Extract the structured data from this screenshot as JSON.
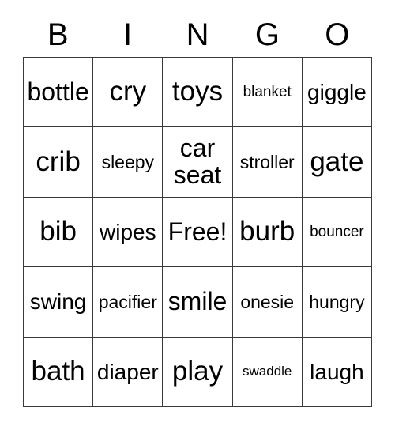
{
  "card": {
    "headers": [
      "B",
      "I",
      "N",
      "G",
      "O"
    ],
    "free_space_label": "Free!",
    "colors": {
      "background": "#ffffff",
      "border": "#3a3a3a",
      "text": "#000000"
    },
    "rows": [
      [
        {
          "label": "bottle",
          "size": "lg"
        },
        {
          "label": "cry",
          "size": "xl"
        },
        {
          "label": "toys",
          "size": "xl"
        },
        {
          "label": "blanket",
          "size": "xs"
        },
        {
          "label": "giggle",
          "size": "md"
        }
      ],
      [
        {
          "label": "crib",
          "size": "xl"
        },
        {
          "label": "sleepy",
          "size": "sm"
        },
        {
          "label": "car seat",
          "size": "lg"
        },
        {
          "label": "stroller",
          "size": "sm"
        },
        {
          "label": "gate",
          "size": "xl"
        }
      ],
      [
        {
          "label": "bib",
          "size": "xl"
        },
        {
          "label": "wipes",
          "size": "md"
        },
        {
          "label": "Free!",
          "size": "lg"
        },
        {
          "label": "burb",
          "size": "xl"
        },
        {
          "label": "bouncer",
          "size": "xs"
        }
      ],
      [
        {
          "label": "swing",
          "size": "md"
        },
        {
          "label": "pacifier",
          "size": "sm"
        },
        {
          "label": "smile",
          "size": "lg"
        },
        {
          "label": "onesie",
          "size": "sm"
        },
        {
          "label": "hungry",
          "size": "sm"
        }
      ],
      [
        {
          "label": "bath",
          "size": "xl"
        },
        {
          "label": "diaper",
          "size": "md"
        },
        {
          "label": "play",
          "size": "xl"
        },
        {
          "label": "swaddle",
          "size": "xxs"
        },
        {
          "label": "laugh",
          "size": "md"
        }
      ]
    ]
  }
}
